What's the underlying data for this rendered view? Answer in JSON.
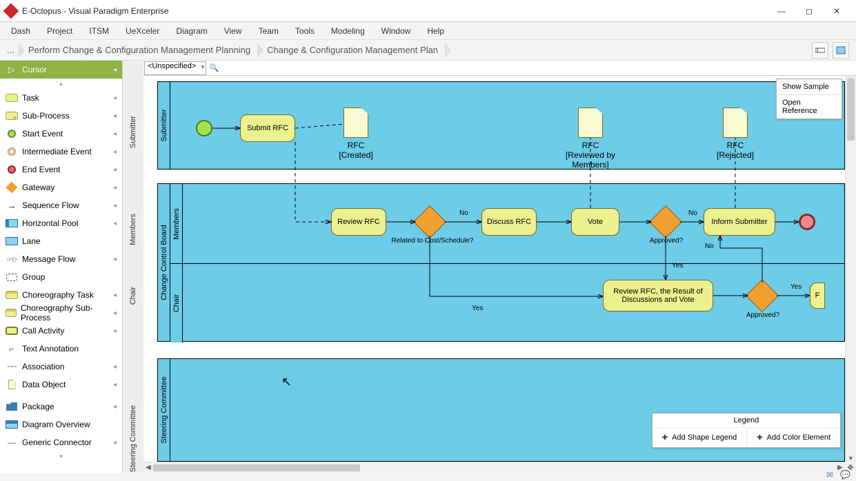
{
  "titlebar": {
    "title": "E-Octopus - Visual Paradigm Enterprise"
  },
  "menu": [
    "Dash",
    "Project",
    "ITSM",
    "UeXceler",
    "Diagram",
    "View",
    "Team",
    "Tools",
    "Modeling",
    "Window",
    "Help"
  ],
  "breadcrumb": {
    "ellipsis": "...",
    "items": [
      "Perform Change & Configuration Management Planning",
      "Change & Configuration Management Plan"
    ]
  },
  "palette": {
    "cursor": "Cursor",
    "items": [
      "Task",
      "Sub-Process",
      "Start Event",
      "Intermediate Event",
      "End Event",
      "Gateway",
      "Sequence Flow",
      "Horizontal Pool",
      "Lane",
      "Message Flow",
      "Group",
      "Choreography Task",
      "Choreography Sub-Process",
      "Call Activity",
      "Text Annotation",
      "Association",
      "Data Object",
      "Package",
      "Diagram Overview",
      "Generic Connector"
    ]
  },
  "canvas_toolbar": {
    "combo": "<Unspecified>"
  },
  "context_menu": [
    "Show Sample",
    "Open Reference"
  ],
  "legend": {
    "title": "Legend",
    "add_shape": "Add Shape Legend",
    "add_color": "Add Color Element"
  },
  "diagram": {
    "pools": {
      "submitter": {
        "header": "Submitter"
      },
      "ccb": {
        "header": "Change Control Board",
        "lanes": [
          "Members",
          "Chair"
        ]
      },
      "steering": {
        "header": "Steering Committee"
      }
    },
    "tasks": {
      "submit_rfc": "Submit RFC",
      "review_rfc": "Review RFC",
      "discuss_rfc": "Discuss RFC",
      "vote": "Vote",
      "inform_submitter": "Inform Submitter",
      "review_result": "Review RFC, the Result of Discussions and Vote",
      "partial_f": "F"
    },
    "data_objects": {
      "rfc_created": {
        "name": "RFC",
        "state": "[Created]"
      },
      "rfc_reviewed": {
        "name": "RFC",
        "state": "[Reviewed by Members]"
      },
      "rfc_rejected": {
        "name": "RFC",
        "state": "[Rejected]"
      }
    },
    "gateway_labels": {
      "cost_sched": "Related to Cost/Schedule?",
      "approved1": "Approved?",
      "approved2": "Approved?"
    },
    "edge_labels": {
      "no": "No",
      "yes": "Yes"
    }
  },
  "outer_lane_labels": [
    "Submitter",
    "Members",
    "Chair",
    "Steering Committee"
  ]
}
